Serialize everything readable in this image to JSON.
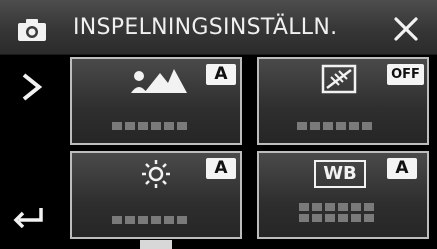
{
  "header": {
    "title": "INSPELNINGSINSTÄLLN.",
    "mode_icon": "camera-icon",
    "close_icon": "close-icon"
  },
  "nav": {
    "next_icon": "chevron-right-icon",
    "back_icon": "return-arrow-icon"
  },
  "tiles": [
    {
      "id": "scene",
      "icon": "scene-mountain-person-icon",
      "badge": "A"
    },
    {
      "id": "backlight",
      "icon": "backlight-compensation-icon",
      "badge": "OFF"
    },
    {
      "id": "brightness",
      "icon": "brightness-sun-icon",
      "badge": "A"
    },
    {
      "id": "white_balance",
      "icon": "wb-icon",
      "icon_text": "WB",
      "badge": "A"
    }
  ],
  "colors": {
    "header_bg": "#3a3a3a",
    "tile_border": "#bdbdbd",
    "badge_bg": "#f4f4f4",
    "placeholder": "#7a7a7a"
  }
}
